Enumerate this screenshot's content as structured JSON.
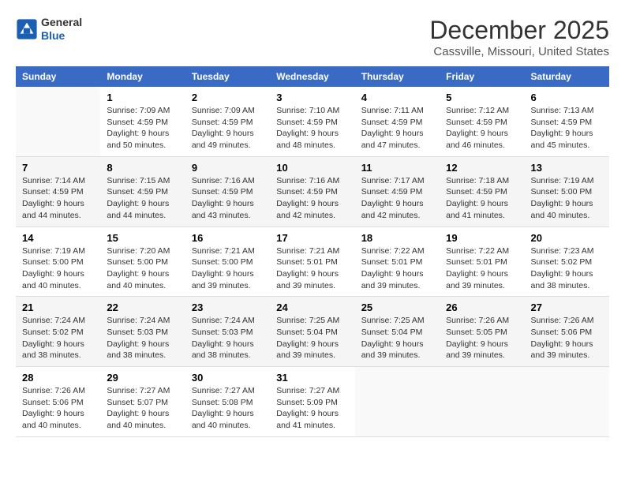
{
  "header": {
    "logo": {
      "general": "General",
      "blue": "Blue"
    },
    "title": "December 2025",
    "location": "Cassville, Missouri, United States"
  },
  "days_of_week": [
    "Sunday",
    "Monday",
    "Tuesday",
    "Wednesday",
    "Thursday",
    "Friday",
    "Saturday"
  ],
  "weeks": [
    [
      {
        "day": "",
        "info": ""
      },
      {
        "day": "1",
        "info": "Sunrise: 7:09 AM\nSunset: 4:59 PM\nDaylight: 9 hours\nand 50 minutes."
      },
      {
        "day": "2",
        "info": "Sunrise: 7:09 AM\nSunset: 4:59 PM\nDaylight: 9 hours\nand 49 minutes."
      },
      {
        "day": "3",
        "info": "Sunrise: 7:10 AM\nSunset: 4:59 PM\nDaylight: 9 hours\nand 48 minutes."
      },
      {
        "day": "4",
        "info": "Sunrise: 7:11 AM\nSunset: 4:59 PM\nDaylight: 9 hours\nand 47 minutes."
      },
      {
        "day": "5",
        "info": "Sunrise: 7:12 AM\nSunset: 4:59 PM\nDaylight: 9 hours\nand 46 minutes."
      },
      {
        "day": "6",
        "info": "Sunrise: 7:13 AM\nSunset: 4:59 PM\nDaylight: 9 hours\nand 45 minutes."
      }
    ],
    [
      {
        "day": "7",
        "info": "Sunrise: 7:14 AM\nSunset: 4:59 PM\nDaylight: 9 hours\nand 44 minutes."
      },
      {
        "day": "8",
        "info": "Sunrise: 7:15 AM\nSunset: 4:59 PM\nDaylight: 9 hours\nand 44 minutes."
      },
      {
        "day": "9",
        "info": "Sunrise: 7:16 AM\nSunset: 4:59 PM\nDaylight: 9 hours\nand 43 minutes."
      },
      {
        "day": "10",
        "info": "Sunrise: 7:16 AM\nSunset: 4:59 PM\nDaylight: 9 hours\nand 42 minutes."
      },
      {
        "day": "11",
        "info": "Sunrise: 7:17 AM\nSunset: 4:59 PM\nDaylight: 9 hours\nand 42 minutes."
      },
      {
        "day": "12",
        "info": "Sunrise: 7:18 AM\nSunset: 4:59 PM\nDaylight: 9 hours\nand 41 minutes."
      },
      {
        "day": "13",
        "info": "Sunrise: 7:19 AM\nSunset: 5:00 PM\nDaylight: 9 hours\nand 40 minutes."
      }
    ],
    [
      {
        "day": "14",
        "info": "Sunrise: 7:19 AM\nSunset: 5:00 PM\nDaylight: 9 hours\nand 40 minutes."
      },
      {
        "day": "15",
        "info": "Sunrise: 7:20 AM\nSunset: 5:00 PM\nDaylight: 9 hours\nand 40 minutes."
      },
      {
        "day": "16",
        "info": "Sunrise: 7:21 AM\nSunset: 5:00 PM\nDaylight: 9 hours\nand 39 minutes."
      },
      {
        "day": "17",
        "info": "Sunrise: 7:21 AM\nSunset: 5:01 PM\nDaylight: 9 hours\nand 39 minutes."
      },
      {
        "day": "18",
        "info": "Sunrise: 7:22 AM\nSunset: 5:01 PM\nDaylight: 9 hours\nand 39 minutes."
      },
      {
        "day": "19",
        "info": "Sunrise: 7:22 AM\nSunset: 5:01 PM\nDaylight: 9 hours\nand 39 minutes."
      },
      {
        "day": "20",
        "info": "Sunrise: 7:23 AM\nSunset: 5:02 PM\nDaylight: 9 hours\nand 38 minutes."
      }
    ],
    [
      {
        "day": "21",
        "info": "Sunrise: 7:24 AM\nSunset: 5:02 PM\nDaylight: 9 hours\nand 38 minutes."
      },
      {
        "day": "22",
        "info": "Sunrise: 7:24 AM\nSunset: 5:03 PM\nDaylight: 9 hours\nand 38 minutes."
      },
      {
        "day": "23",
        "info": "Sunrise: 7:24 AM\nSunset: 5:03 PM\nDaylight: 9 hours\nand 38 minutes."
      },
      {
        "day": "24",
        "info": "Sunrise: 7:25 AM\nSunset: 5:04 PM\nDaylight: 9 hours\nand 39 minutes."
      },
      {
        "day": "25",
        "info": "Sunrise: 7:25 AM\nSunset: 5:04 PM\nDaylight: 9 hours\nand 39 minutes."
      },
      {
        "day": "26",
        "info": "Sunrise: 7:26 AM\nSunset: 5:05 PM\nDaylight: 9 hours\nand 39 minutes."
      },
      {
        "day": "27",
        "info": "Sunrise: 7:26 AM\nSunset: 5:06 PM\nDaylight: 9 hours\nand 39 minutes."
      }
    ],
    [
      {
        "day": "28",
        "info": "Sunrise: 7:26 AM\nSunset: 5:06 PM\nDaylight: 9 hours\nand 40 minutes."
      },
      {
        "day": "29",
        "info": "Sunrise: 7:27 AM\nSunset: 5:07 PM\nDaylight: 9 hours\nand 40 minutes."
      },
      {
        "day": "30",
        "info": "Sunrise: 7:27 AM\nSunset: 5:08 PM\nDaylight: 9 hours\nand 40 minutes."
      },
      {
        "day": "31",
        "info": "Sunrise: 7:27 AM\nSunset: 5:09 PM\nDaylight: 9 hours\nand 41 minutes."
      },
      {
        "day": "",
        "info": ""
      },
      {
        "day": "",
        "info": ""
      },
      {
        "day": "",
        "info": ""
      }
    ]
  ]
}
